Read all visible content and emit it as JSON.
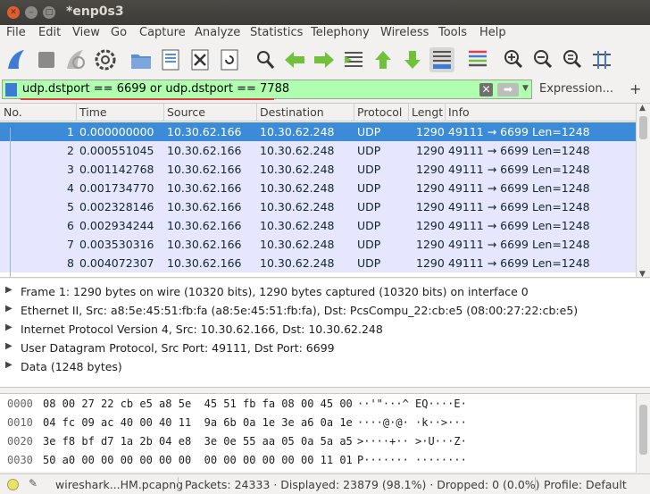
{
  "window": {
    "title": "*enp0s3"
  },
  "menu": [
    "File",
    "Edit",
    "View",
    "Go",
    "Capture",
    "Analyze",
    "Statistics",
    "Telephony",
    "Wireless",
    "Tools",
    "Help"
  ],
  "toolbar": {
    "icons": [
      "start-capture-icon",
      "stop-capture-icon",
      "restart-capture-icon",
      "capture-options-icon",
      "open-file-icon",
      "save-file-icon",
      "close-file-icon",
      "reload-file-icon",
      "find-packet-icon",
      "go-back-icon",
      "go-forward-icon",
      "go-to-packet-icon",
      "go-first-icon",
      "go-last-icon",
      "autoscroll-icon",
      "colorize-icon",
      "zoom-in-icon",
      "zoom-out-icon",
      "zoom-normal-icon",
      "resize-columns-icon"
    ]
  },
  "filter": {
    "value": "udp.dstport == 6699 or udp.dstport == 7788",
    "expression_label": "Expression...",
    "plus_label": "+",
    "color": "#afffaf"
  },
  "packet_list": {
    "columns": [
      "No.",
      "Time",
      "Source",
      "Destination",
      "Protocol",
      "Lengtl",
      "Info"
    ],
    "rows": [
      {
        "no": "1",
        "time": "0.000000000",
        "src": "10.30.62.166",
        "dst": "10.30.62.248",
        "proto": "UDP",
        "len": "1290",
        "info": "49111  →  6699  Len=1248"
      },
      {
        "no": "2",
        "time": "0.000551045",
        "src": "10.30.62.166",
        "dst": "10.30.62.248",
        "proto": "UDP",
        "len": "1290",
        "info": "49111  →  6699  Len=1248"
      },
      {
        "no": "3",
        "time": "0.001142768",
        "src": "10.30.62.166",
        "dst": "10.30.62.248",
        "proto": "UDP",
        "len": "1290",
        "info": "49111  →  6699  Len=1248"
      },
      {
        "no": "4",
        "time": "0.001734770",
        "src": "10.30.62.166",
        "dst": "10.30.62.248",
        "proto": "UDP",
        "len": "1290",
        "info": "49111  →  6699  Len=1248"
      },
      {
        "no": "5",
        "time": "0.002328146",
        "src": "10.30.62.166",
        "dst": "10.30.62.248",
        "proto": "UDP",
        "len": "1290",
        "info": "49111  →  6699  Len=1248"
      },
      {
        "no": "6",
        "time": "0.002934244",
        "src": "10.30.62.166",
        "dst": "10.30.62.248",
        "proto": "UDP",
        "len": "1290",
        "info": "49111  →  6699  Len=1248"
      },
      {
        "no": "7",
        "time": "0.003530316",
        "src": "10.30.62.166",
        "dst": "10.30.62.248",
        "proto": "UDP",
        "len": "1290",
        "info": "49111  →  6699  Len=1248"
      },
      {
        "no": "8",
        "time": "0.004072307",
        "src": "10.30.62.166",
        "dst": "10.30.62.248",
        "proto": "UDP",
        "len": "1290",
        "info": "49111  →  6699  Len=1248"
      }
    ],
    "selected_row": 0,
    "row_color": "#e7e6ff",
    "selected_color": "#3b8bd9"
  },
  "details": [
    "Frame 1: 1290 bytes on wire (10320 bits), 1290 bytes captured (10320 bits) on interface 0",
    "Ethernet II, Src: a8:5e:45:51:fb:fa (a8:5e:45:51:fb:fa), Dst: PcsCompu_22:cb:e5 (08:00:27:22:cb:e5)",
    "Internet Protocol Version 4, Src: 10.30.62.166, Dst: 10.30.62.248",
    "User Datagram Protocol, Src Port: 49111, Dst Port: 6699",
    "Data (1248 bytes)"
  ],
  "bytes": [
    {
      "offset": "0000",
      "hex": "08 00 27 22 cb e5 a8 5e  45 51 fb fa 08 00 45 00",
      "ascii": "··'\"···^ EQ····E·"
    },
    {
      "offset": "0010",
      "hex": "04 fc 09 ac 40 00 40 11  9a 6b 0a 1e 3e a6 0a 1e",
      "ascii": "····@·@· ·k··>···"
    },
    {
      "offset": "0020",
      "hex": "3e f8 bf d7 1a 2b 04 e8  3e 0e 55 aa 05 0a 5a a5",
      "ascii": ">····+·· >·U···Z·"
    },
    {
      "offset": "0030",
      "hex": "50 a0 00 00 00 00 00 00  00 00 00 00 00 00 11 01",
      "ascii": "P······· ········"
    }
  ],
  "status": {
    "file": "wireshark...HM.pcapng",
    "packets": "Packets: 24333 · Displayed: 23879 (98.1%) · Dropped: 0 (0.0%)",
    "profile": "Profile: Default"
  }
}
